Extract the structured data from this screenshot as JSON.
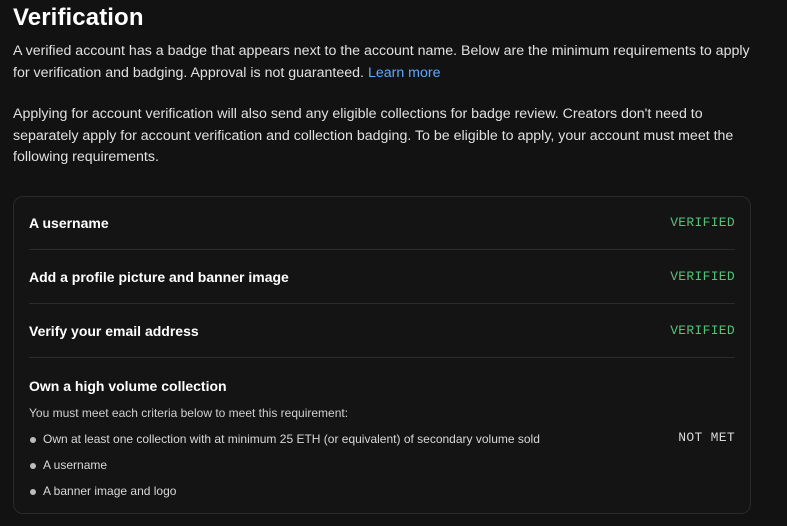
{
  "page": {
    "title": "Verification",
    "intro_text": "A verified account has a badge that appears next to the account name. Below are the minimum requirements to apply for verification and badging. Approval is not guaranteed.",
    "learn_more_label": "Learn more",
    "intro_text_2": "Applying for account verification will also send any eligible collections for badge review. Creators don't need to separately apply for account verification and collection badging. To be eligible to apply, your account must meet the following requirements."
  },
  "requirements": [
    {
      "label": "A username",
      "status": "VERIFIED"
    },
    {
      "label": "Add a profile picture and banner image",
      "status": "VERIFIED"
    },
    {
      "label": "Verify your email address",
      "status": "VERIFIED"
    }
  ],
  "high_volume": {
    "label": "Own a high volume collection",
    "note": "You must meet each criteria below to meet this requirement:",
    "criteria": [
      "Own at least one collection with at minimum 25 ETH (or equivalent) of secondary volume sold",
      "A username",
      "A banner image and logo"
    ],
    "status": "NOT MET"
  },
  "colors": {
    "background": "#121212",
    "verified": "#53c27a",
    "link": "#5aa9ff"
  }
}
